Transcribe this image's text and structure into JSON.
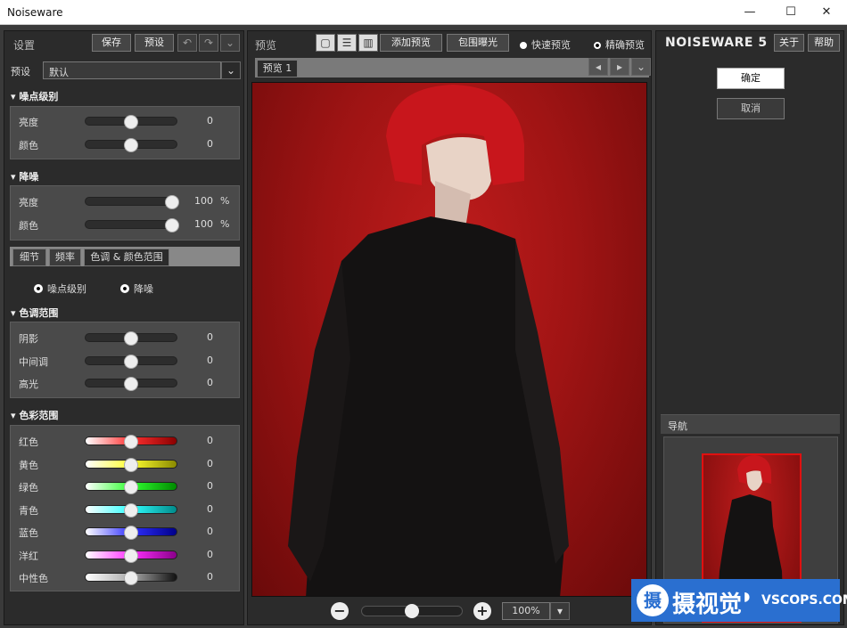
{
  "window": {
    "title": "Noiseware",
    "min": "—",
    "max": "☐",
    "close": "✕"
  },
  "left": {
    "header": "设置",
    "save": "保存",
    "preset_btn": "预设",
    "preset_label": "预设",
    "preset_value": "默认",
    "noise_level": {
      "title": "噪点级别",
      "rows": [
        {
          "label": "亮度",
          "value": "0",
          "pos": 0.5
        },
        {
          "label": "颜色",
          "value": "0",
          "pos": 0.5
        }
      ]
    },
    "denoise": {
      "title": "降噪",
      "rows": [
        {
          "label": "亮度",
          "value": "100",
          "unit": "%",
          "pos": 0.95
        },
        {
          "label": "颜色",
          "value": "100",
          "unit": "%",
          "pos": 0.95
        }
      ]
    },
    "tabs": [
      "细节",
      "频率",
      "色调 & 颜色范围"
    ],
    "radios": [
      "噪点级别",
      "降噪"
    ],
    "tone": {
      "title": "色调范围",
      "rows": [
        {
          "label": "阴影",
          "value": "0",
          "pos": 0.5
        },
        {
          "label": "中间调",
          "value": "0",
          "pos": 0.5
        },
        {
          "label": "高光",
          "value": "0",
          "pos": 0.5
        }
      ]
    },
    "color": {
      "title": "色彩范围",
      "rows": [
        {
          "label": "红色",
          "value": "0",
          "pos": 0.5,
          "g1": "#ffffff",
          "g2": "#ff3030",
          "g3": "#8a0000"
        },
        {
          "label": "黄色",
          "value": "0",
          "pos": 0.5,
          "g1": "#ffffff",
          "g2": "#ffff30",
          "g3": "#8a8a00"
        },
        {
          "label": "绿色",
          "value": "0",
          "pos": 0.5,
          "g1": "#ffffff",
          "g2": "#30ff30",
          "g3": "#008a00"
        },
        {
          "label": "青色",
          "value": "0",
          "pos": 0.5,
          "g1": "#ffffff",
          "g2": "#30ffff",
          "g3": "#008a8a"
        },
        {
          "label": "蓝色",
          "value": "0",
          "pos": 0.5,
          "g1": "#ffffff",
          "g2": "#3030ff",
          "g3": "#00008a"
        },
        {
          "label": "洋红",
          "value": "0",
          "pos": 0.5,
          "g1": "#ffffff",
          "g2": "#ff30ff",
          "g3": "#8a008a"
        },
        {
          "label": "中性色",
          "value": "0",
          "pos": 0.5,
          "g1": "#ffffff",
          "g2": "#aaaaaa",
          "g3": "#111111"
        }
      ]
    }
  },
  "center": {
    "header": "预览",
    "add_preview": "添加预览",
    "bracket": "包围曝光",
    "fast_preview": "快速预览",
    "accurate_preview": "精确预览",
    "tab": "预览 1",
    "zoom": "100%",
    "zoom_pos": 0.5
  },
  "right": {
    "brand": "NOISEWARE",
    "brand_num": "5",
    "about": "关于",
    "help": "帮助",
    "ok": "确定",
    "cancel": "取消",
    "nav": "导航"
  },
  "watermark": {
    "text": "摄视觉",
    "domain": "VSCOPS.COM"
  }
}
